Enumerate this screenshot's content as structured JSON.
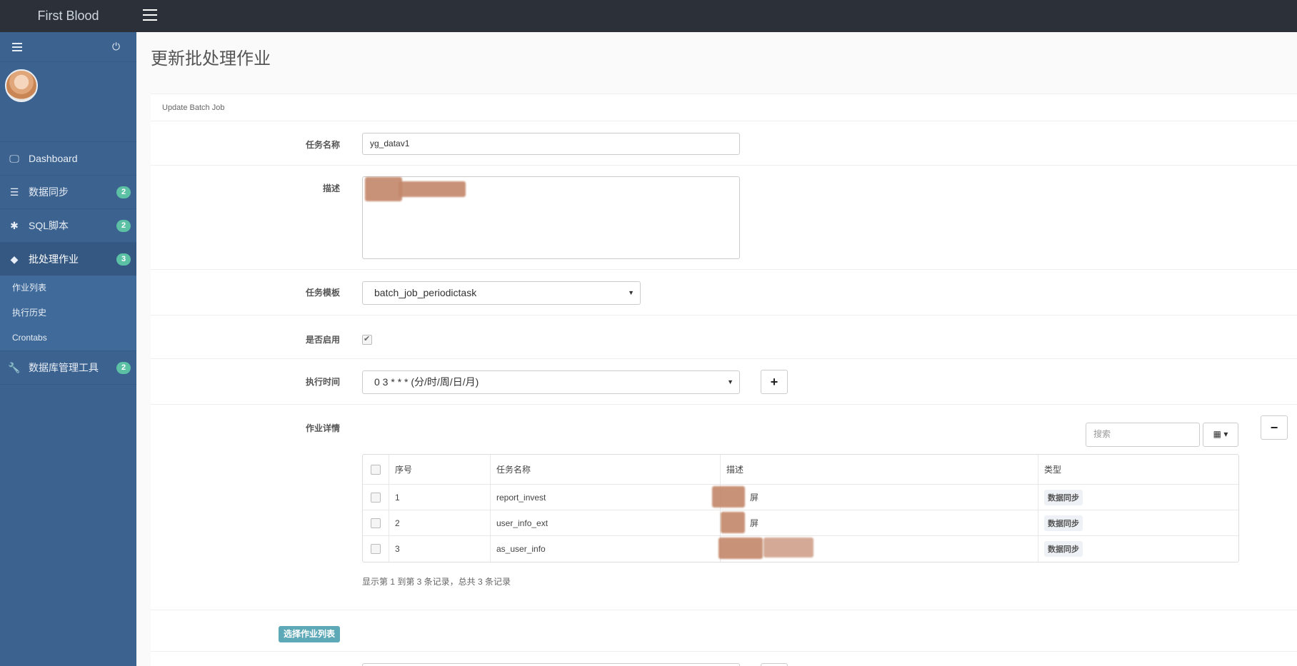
{
  "app": {
    "brand": "First Blood"
  },
  "sidebar": {
    "items": [
      {
        "label": "Dashboard",
        "icon": "monitor-icon",
        "badge": ""
      },
      {
        "label": "数据同步",
        "icon": "server-icon",
        "badge": "2"
      },
      {
        "label": "SQL脚本",
        "icon": "asterisk-icon",
        "badge": "2"
      },
      {
        "label": "批处理作业",
        "icon": "tag-icon",
        "badge": "3"
      },
      {
        "label": "数据库管理工具",
        "icon": "wrench-icon",
        "badge": "2"
      }
    ],
    "submenu": [
      "作业列表",
      "执行历史",
      "Crontabs"
    ]
  },
  "page": {
    "title": "更新批处理作业",
    "panel_heading": "Update Batch Job"
  },
  "form": {
    "name_label": "任务名称",
    "name_value": "yg_datav1",
    "desc_label": "描述",
    "template_label": "任务模板",
    "template_value": "batch_job_periodictask",
    "enabled_label": "是否启用",
    "enabled": true,
    "schedule_label": "执行时间",
    "schedule_value": "0 3 * * * (分/时/周/日/月)",
    "details_label": "作业详情"
  },
  "table": {
    "search_placeholder": "搜索",
    "columns": [
      "序号",
      "任务名称",
      "描述",
      "类型"
    ],
    "rows": [
      {
        "index": "1",
        "name": "report_invest",
        "desc_suffix": "屏",
        "type": "数据同步"
      },
      {
        "index": "2",
        "name": "user_info_ext",
        "desc_suffix": "屏",
        "type": "数据同步"
      },
      {
        "index": "3",
        "name": "as_user_info",
        "desc_suffix": "",
        "type": "数据同步"
      }
    ],
    "summary": "显示第 1 到第 3 条记录，总共 3 条记录"
  },
  "select_jobs_button": "选择作业列表",
  "colors": {
    "topbar": "#2b3039",
    "sidebar": "#3c6290",
    "badge": "#5bc0a4",
    "primary": "#5ea9b7"
  }
}
